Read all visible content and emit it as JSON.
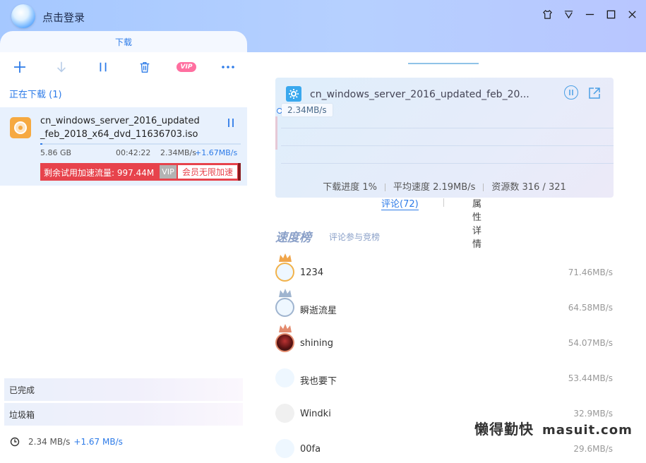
{
  "titlebar": {
    "login_label": "点击登录",
    "tab_label": "下载"
  },
  "toolbar": {
    "vip_label": "VIP"
  },
  "left": {
    "section_title": "正在下载 (1)",
    "task": {
      "filename": "cn_windows_server_2016_updated_feb_2018_x64_dvd_11636703.iso",
      "size": "5.86 GB",
      "remaining_time": "00:42:22",
      "speed": "2.34MB/s",
      "accel_speed": "+1.67MB/s",
      "progress_fraction": 0.01,
      "trial_text": "剩余试用加速流量: 997.44M",
      "vip_label": "VIP",
      "member_label": "会员无限加速"
    },
    "completed_label": "已完成",
    "trash_label": "垃圾箱",
    "footer_speed": "2.34 MB/s",
    "footer_accel": "+1.67 MB/s"
  },
  "detail": {
    "name": "cn_windows_server_2016_updated_feb_20...",
    "current_speed": "2.34MB/s",
    "progress_text": "下载进度 1%",
    "avg_speed_text": "平均速度 2.19MB/s",
    "resources_text": "资源数 316 / 321",
    "tab_comments": "评论(72)",
    "tab_properties": "属性详情"
  },
  "ranking": {
    "title": "速度榜",
    "subtitle": "评论参与竞榜",
    "entries": [
      {
        "name": "1234",
        "speed": "71.46MB/s"
      },
      {
        "name": "瞬逝流星",
        "speed": "64.58MB/s"
      },
      {
        "name": "shining",
        "speed": "54.07MB/s"
      },
      {
        "name": "我也要下",
        "speed": "53.44MB/s"
      },
      {
        "name": "Windki",
        "speed": "32.9MB/s"
      },
      {
        "name": "00fa",
        "speed": "29.6MB/s"
      }
    ]
  },
  "watermark": {
    "cn": "懒得勤快",
    "en": "masuit.com"
  },
  "colors": {
    "accent": "#2d7be8",
    "accel_red": "#e7434c",
    "topbar": "#b3cdff"
  }
}
